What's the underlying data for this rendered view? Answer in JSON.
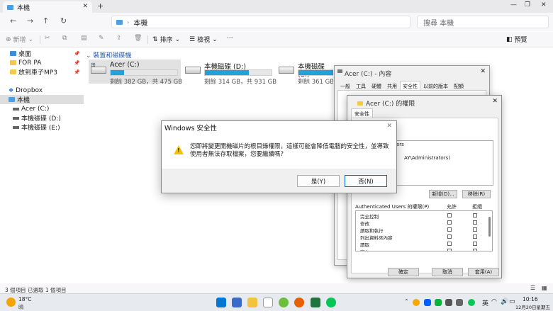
{
  "window": {
    "tab_title": "本機",
    "address_path": "本機",
    "search_placeholder": "搜尋 本機"
  },
  "commandbar": {
    "new_label": "新增",
    "sort_label": "排序",
    "view_label": "檢視",
    "preview_label": "預覽"
  },
  "navpane": {
    "items": [
      {
        "label": "桌面",
        "pinned": true
      },
      {
        "label": "FOR PA",
        "pinned": true
      },
      {
        "label": "放到車子MP3",
        "pinned": true
      },
      {
        "label": "Dropbox",
        "pinned": false
      },
      {
        "label": "本機",
        "pinned": false
      },
      {
        "label": "Acer (C:)",
        "pinned": false
      },
      {
        "label": "本機磁碟 (D:)",
        "pinned": false
      },
      {
        "label": "本機磁碟 (E:)",
        "pinned": false
      }
    ]
  },
  "content": {
    "section_title": "裝置和磁碟機",
    "drives": [
      {
        "name": "Acer (C:)",
        "info": "剩餘 382 GB，共 475 GB",
        "used_fraction": 0.2
      },
      {
        "name": "本機磁碟 (D:)",
        "info": "剩餘 314 GB，共 931 GB",
        "used_fraction": 0.66
      },
      {
        "name": "本機磁碟 (E:)",
        "info": "剩餘 361 GB",
        "used_fraction": 0.6
      }
    ]
  },
  "statusbar": {
    "count": "3 個項目",
    "selected": "已選取 1 個項目"
  },
  "properties_window": {
    "title": "Acer (C:) - 內容",
    "tabs": [
      "一般",
      "工具",
      "硬體",
      "共用",
      "安全性",
      "以前的版本",
      "配額"
    ],
    "active_tab": "安全性"
  },
  "permissions_window": {
    "title": "Acer (C:) 的權限",
    "tab": "安全性",
    "group_partial_1": "ers",
    "group_partial_2": "AY\\Administrators)",
    "add_button": "新增(D)...",
    "remove_button": "移除(R)",
    "permissions_label": "Authenticated Users 的權限(P)",
    "allow_col": "允許",
    "deny_col": "拒絕",
    "permissions": [
      "完全控制",
      "修改",
      "讀取和執行",
      "列出資料夾內容",
      "讀取",
      "寫入"
    ],
    "ok_button": "確定",
    "cancel_button": "取消",
    "apply_button": "套用(A)"
  },
  "security_dialog": {
    "title": "Windows 安全性",
    "message": "您即將變更開機磁片的根目錄權限，這樣可能會降低電腦的安全性，並導致使用者無法存取檔案，您要繼續嗎?",
    "yes_button": "是(Y)",
    "no_button": "否(N)"
  },
  "taskbar": {
    "temperature": "18°C",
    "weather": "晴",
    "ime": "英",
    "time": "10:16",
    "date": "12月20日星期五"
  }
}
